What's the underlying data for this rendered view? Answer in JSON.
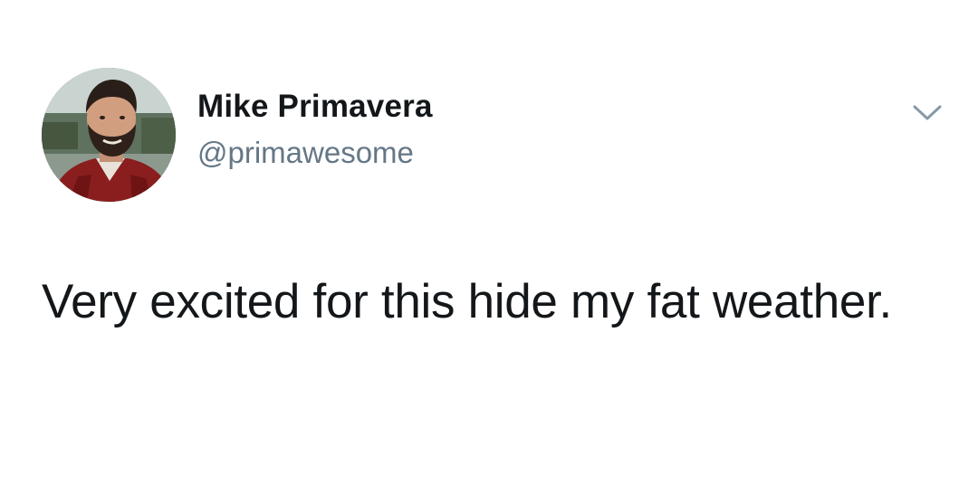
{
  "tweet": {
    "author": {
      "display_name": "Mike Primavera",
      "handle": "@primawesome",
      "avatar_icon": "profile-photo"
    },
    "menu_icon": "chevron-down-icon",
    "text": "Very excited for this hide my fat weather."
  },
  "colors": {
    "background": "#ffffff",
    "primary_text": "#14171a",
    "secondary_text": "#657786",
    "chevron": "#8899a6"
  }
}
